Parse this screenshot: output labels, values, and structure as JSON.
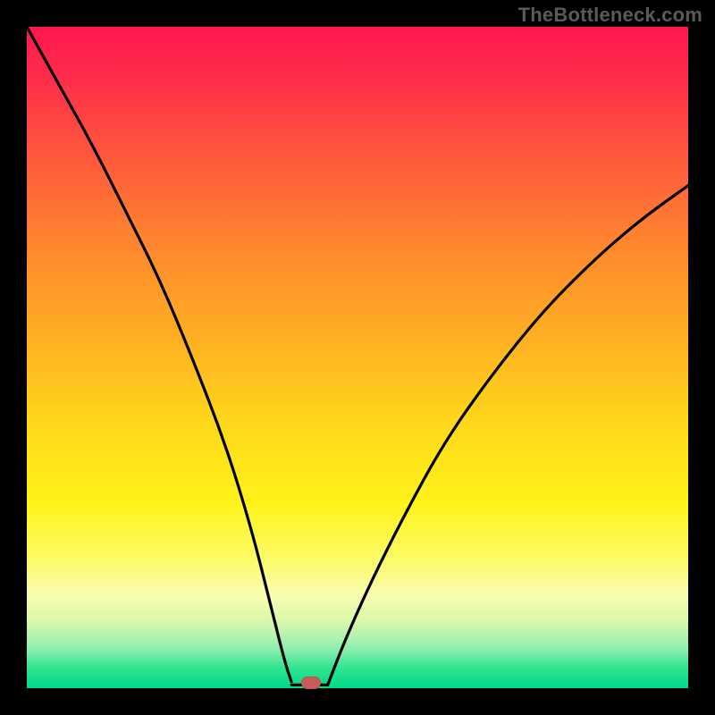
{
  "watermark": "TheBottleneck.com",
  "colors": {
    "frame": "#000000",
    "curve": "#000000",
    "marker": "#c95b58",
    "gradient_top": "#ff1650",
    "gradient_bottom": "#00d988"
  },
  "chart_data": {
    "type": "line",
    "title": "",
    "xlabel": "",
    "ylabel": "",
    "xlim": [
      0,
      1
    ],
    "ylim": [
      0,
      1
    ],
    "grid": false,
    "legend": false,
    "annotations": [],
    "marker": {
      "x": 0.43,
      "y": 0.005,
      "shape": "rounded-rect"
    },
    "left_branch": {
      "description": "steep descending curve from top-left to valley",
      "points": [
        {
          "x": 0.0,
          "y": 1.0
        },
        {
          "x": 0.05,
          "y": 0.91
        },
        {
          "x": 0.1,
          "y": 0.82
        },
        {
          "x": 0.15,
          "y": 0.72
        },
        {
          "x": 0.2,
          "y": 0.62
        },
        {
          "x": 0.25,
          "y": 0.5
        },
        {
          "x": 0.3,
          "y": 0.37
        },
        {
          "x": 0.34,
          "y": 0.24
        },
        {
          "x": 0.37,
          "y": 0.12
        },
        {
          "x": 0.39,
          "y": 0.04
        },
        {
          "x": 0.4,
          "y": 0.01
        }
      ]
    },
    "valley_floor": {
      "description": "short flat segment at valley bottom",
      "points": [
        {
          "x": 0.4,
          "y": 0.005
        },
        {
          "x": 0.455,
          "y": 0.005
        }
      ]
    },
    "right_branch": {
      "description": "curve rising from valley toward upper-right, concave",
      "points": [
        {
          "x": 0.455,
          "y": 0.005
        },
        {
          "x": 0.48,
          "y": 0.07
        },
        {
          "x": 0.52,
          "y": 0.16
        },
        {
          "x": 0.57,
          "y": 0.26
        },
        {
          "x": 0.63,
          "y": 0.37
        },
        {
          "x": 0.7,
          "y": 0.47
        },
        {
          "x": 0.78,
          "y": 0.57
        },
        {
          "x": 0.86,
          "y": 0.65
        },
        {
          "x": 0.93,
          "y": 0.71
        },
        {
          "x": 1.0,
          "y": 0.76
        }
      ]
    }
  }
}
